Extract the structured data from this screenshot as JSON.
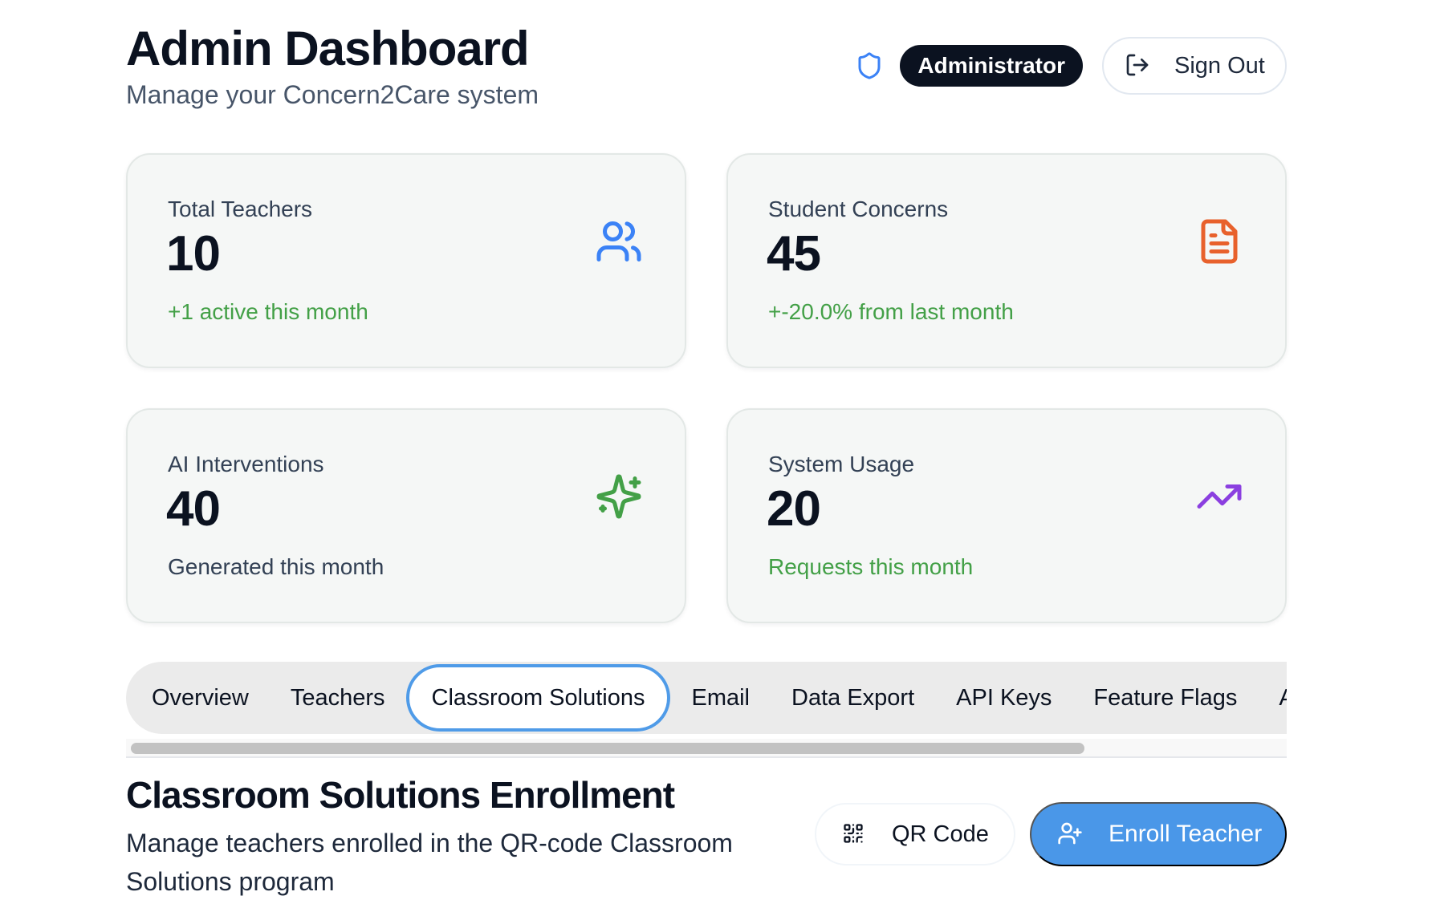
{
  "header": {
    "title": "Admin Dashboard",
    "subtitle": "Manage your Concern2Care system",
    "role_badge": "Administrator",
    "sign_out_label": "Sign Out",
    "shield_icon": "shield-icon",
    "sign_out_icon": "log-out-icon"
  },
  "stats": [
    {
      "label": "Total Teachers",
      "value": "10",
      "note": "+1 active this month",
      "icon": "users-icon",
      "icon_color": "#3b82f6",
      "note_color": "#43a047"
    },
    {
      "label": "Student Concerns",
      "value": "45",
      "note": "+-20.0% from last month",
      "icon": "file-text-icon",
      "icon_color": "#e8612c",
      "note_color": "#43a047"
    },
    {
      "label": "AI Interventions",
      "value": "40",
      "note": "Generated this month",
      "icon": "sparkles-icon",
      "icon_color": "#43a047",
      "note_color": "#334155"
    },
    {
      "label": "System Usage",
      "value": "20",
      "note": "Requests this month",
      "icon": "trending-up-icon",
      "icon_color": "#8b3fe0",
      "note_color": "#43a047"
    }
  ],
  "tabs": [
    {
      "label": "Overview",
      "active": false
    },
    {
      "label": "Teachers",
      "active": false
    },
    {
      "label": "Classroom Solutions",
      "active": true
    },
    {
      "label": "Email",
      "active": false
    },
    {
      "label": "Data Export",
      "active": false
    },
    {
      "label": "API Keys",
      "active": false
    },
    {
      "label": "Feature Flags",
      "active": false
    },
    {
      "label": "A",
      "active": false
    }
  ],
  "section": {
    "title": "Classroom Solutions Enrollment",
    "description": "Manage teachers enrolled in the QR-code Classroom Solutions program",
    "qr_button_label": "QR Code",
    "qr_icon": "qr-code-icon",
    "enroll_button_label": "Enroll Teacher",
    "enroll_icon": "user-plus-icon"
  },
  "colors": {
    "accent": "#4a97e8",
    "dark": "#0b1220",
    "positive": "#43a047"
  }
}
